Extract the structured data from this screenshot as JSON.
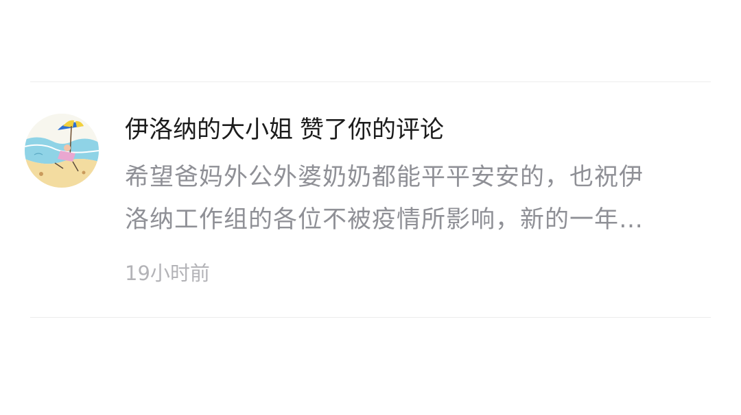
{
  "notification": {
    "user_name": "伊洛纳的大小姐",
    "action_text": "赞了你的评论",
    "comment_line_1": "希望爸妈外公外婆奶奶都能平平安安的，也祝伊",
    "comment_line_2": "洛纳工作组的各位不被疫情所影响，新的一年…",
    "time_ago": "19小时前",
    "avatar_icon": "beach-umbrella-avatar-icon"
  },
  "colors": {
    "title": "#1c1c1c",
    "comment": "#8f9096",
    "time": "#b3b3b7",
    "divider": "#ececec"
  }
}
